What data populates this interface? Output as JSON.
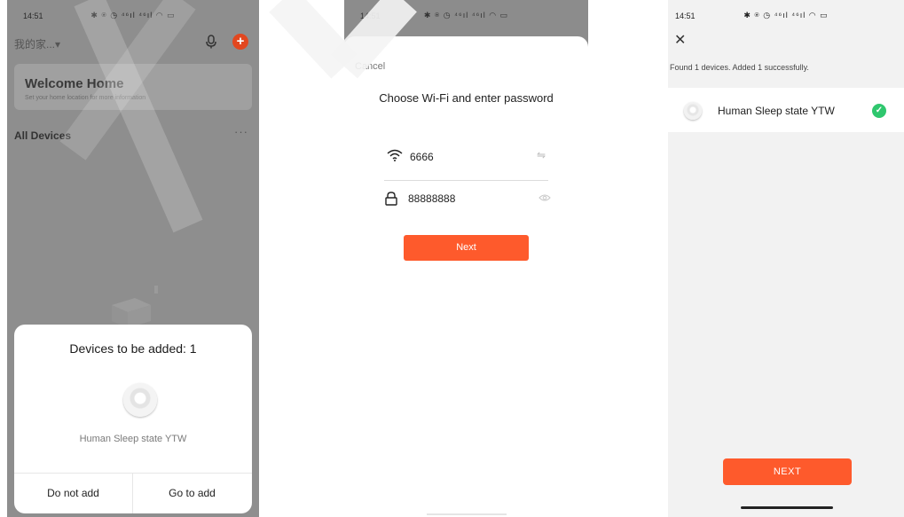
{
  "phone1": {
    "status": {
      "time": "14:51",
      "icons": "✱ ⍟ ◷ ⁴⁶ıl ⁴⁶ıl ◠ ▭"
    },
    "home_selector": "我的家...▾",
    "welcome": {
      "title": "Welcome Home",
      "subtitle": "Set your home location for more information"
    },
    "all_devices": "All Devices",
    "more": "···",
    "sheet": {
      "title": "Devices to be added: 1",
      "device_name": "Human Sleep state YTW",
      "cancel_label": "Do not add",
      "confirm_label": "Go to add"
    }
  },
  "phone2": {
    "status": {
      "time": "14:51",
      "icons": "✱ ⍟ ◷ ⁴⁶ıl ⁴⁶ıl ◠ ▭"
    },
    "cancel": "Cancel",
    "title": "Choose Wi-Fi and enter password",
    "wifi_name": "6666",
    "password": "88888888",
    "next_label": "Next"
  },
  "phone3": {
    "status": {
      "time": "14:51",
      "icons": "✱ ⍟ ◷ ⁴⁶ıl ⁴⁶ıl ◠ ▭"
    },
    "found_text": "Found 1 devices. Added 1 successfully.",
    "device_name": "Human Sleep state YTW",
    "next_label": "NEXT"
  },
  "colors": {
    "accent": "#fe5a2c",
    "success": "#2fc76e",
    "add_button": "#e2471f",
    "dim_overlay": "#8e8e8e"
  },
  "icons": [
    "microphone-icon",
    "add-icon",
    "wifi-icon",
    "swap-icon",
    "lock-icon",
    "eye-icon",
    "close-icon",
    "check-icon",
    "device-icon"
  ]
}
